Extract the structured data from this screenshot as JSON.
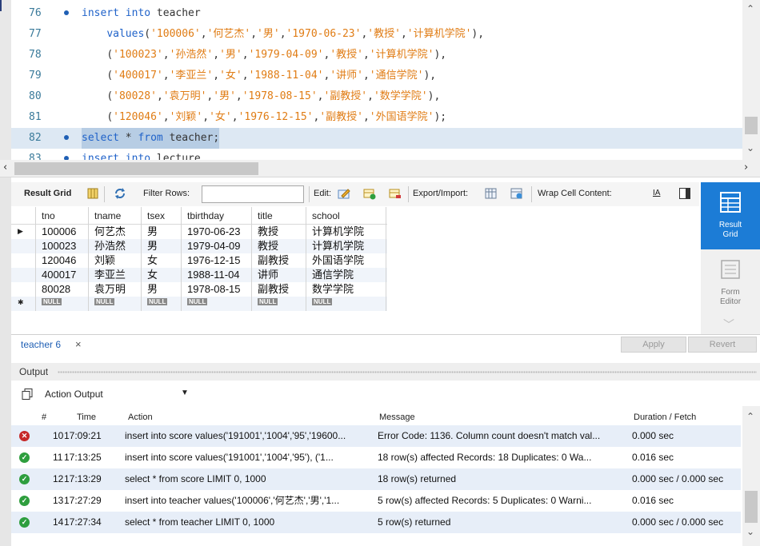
{
  "editor": {
    "lines": [
      {
        "num": "76",
        "dot": true,
        "parts": [
          [
            "kw",
            "insert into "
          ],
          [
            "id",
            "teacher"
          ]
        ]
      },
      {
        "num": "77",
        "dot": false,
        "parts": [
          [
            "id",
            "    "
          ],
          [
            "kw",
            "values"
          ],
          [
            "pun",
            "("
          ],
          [
            "str",
            "'100006'"
          ],
          [
            "pun",
            ","
          ],
          [
            "str",
            "'何艺杰'"
          ],
          [
            "pun",
            ","
          ],
          [
            "str",
            "'男'"
          ],
          [
            "pun",
            ","
          ],
          [
            "str",
            "'1970-06-23'"
          ],
          [
            "pun",
            ","
          ],
          [
            "str",
            "'教授'"
          ],
          [
            "pun",
            ","
          ],
          [
            "str",
            "'计算机学院'"
          ],
          [
            "pun",
            "),"
          ]
        ]
      },
      {
        "num": "78",
        "dot": false,
        "parts": [
          [
            "id",
            "    "
          ],
          [
            "pun",
            "("
          ],
          [
            "str",
            "'100023'"
          ],
          [
            "pun",
            ","
          ],
          [
            "str",
            "'孙浩然'"
          ],
          [
            "pun",
            ","
          ],
          [
            "str",
            "'男'"
          ],
          [
            "pun",
            ","
          ],
          [
            "str",
            "'1979-04-09'"
          ],
          [
            "pun",
            ","
          ],
          [
            "str",
            "'教授'"
          ],
          [
            "pun",
            ","
          ],
          [
            "str",
            "'计算机学院'"
          ],
          [
            "pun",
            "),"
          ]
        ]
      },
      {
        "num": "79",
        "dot": false,
        "parts": [
          [
            "id",
            "    "
          ],
          [
            "pun",
            "("
          ],
          [
            "str",
            "'400017'"
          ],
          [
            "pun",
            ","
          ],
          [
            "str",
            "'李亚兰'"
          ],
          [
            "pun",
            ","
          ],
          [
            "str",
            "'女'"
          ],
          [
            "pun",
            ","
          ],
          [
            "str",
            "'1988-11-04'"
          ],
          [
            "pun",
            ","
          ],
          [
            "str",
            "'讲师'"
          ],
          [
            "pun",
            ","
          ],
          [
            "str",
            "'通信学院'"
          ],
          [
            "pun",
            "),"
          ]
        ]
      },
      {
        "num": "80",
        "dot": false,
        "parts": [
          [
            "id",
            "    "
          ],
          [
            "pun",
            "("
          ],
          [
            "str",
            "'80028'"
          ],
          [
            "pun",
            ","
          ],
          [
            "str",
            "'袁万明'"
          ],
          [
            "pun",
            ","
          ],
          [
            "str",
            "'男'"
          ],
          [
            "pun",
            ","
          ],
          [
            "str",
            "'1978-08-15'"
          ],
          [
            "pun",
            ","
          ],
          [
            "str",
            "'副教授'"
          ],
          [
            "pun",
            ","
          ],
          [
            "str",
            "'数学学院'"
          ],
          [
            "pun",
            "),"
          ]
        ]
      },
      {
        "num": "81",
        "dot": false,
        "parts": [
          [
            "id",
            "    "
          ],
          [
            "pun",
            "("
          ],
          [
            "str",
            "'120046'"
          ],
          [
            "pun",
            ","
          ],
          [
            "str",
            "'刘颖'"
          ],
          [
            "pun",
            ","
          ],
          [
            "str",
            "'女'"
          ],
          [
            "pun",
            ","
          ],
          [
            "str",
            "'1976-12-15'"
          ],
          [
            "pun",
            ","
          ],
          [
            "str",
            "'副教授'"
          ],
          [
            "pun",
            ","
          ],
          [
            "str",
            "'外国语学院'"
          ],
          [
            "pun",
            ");"
          ]
        ]
      },
      {
        "num": "82",
        "dot": true,
        "hl": true,
        "parts": [
          [
            "kw",
            "select"
          ],
          [
            "id",
            " * "
          ],
          [
            "kw",
            "from "
          ],
          [
            "id",
            "teacher;"
          ]
        ]
      },
      {
        "num": "83",
        "dot": true,
        "parts": [
          [
            "kw",
            "insert into "
          ],
          [
            "id",
            "lecture"
          ]
        ]
      }
    ]
  },
  "toolbar": {
    "result_grid": "Result Grid",
    "filter_rows": "Filter Rows:",
    "edit": "Edit:",
    "export_import": "Export/Import:",
    "wrap": "Wrap Cell Content:",
    "wrap_icon_text": "IA"
  },
  "grid": {
    "columns": [
      "tno",
      "tname",
      "tsex",
      "tbirthday",
      "title",
      "school"
    ],
    "rows": [
      [
        "100006",
        "何艺杰",
        "男",
        "1970-06-23",
        "教授",
        "计算机学院"
      ],
      [
        "100023",
        "孙浩然",
        "男",
        "1979-04-09",
        "教授",
        "计算机学院"
      ],
      [
        "120046",
        "刘颖",
        "女",
        "1976-12-15",
        "副教授",
        "外国语学院"
      ],
      [
        "400017",
        "李亚兰",
        "女",
        "1988-11-04",
        "讲师",
        "通信学院"
      ],
      [
        "80028",
        "袁万明",
        "男",
        "1978-08-15",
        "副教授",
        "数学学院"
      ]
    ],
    "null_label": "NULL"
  },
  "side": {
    "result_grid_l1": "Result",
    "result_grid_l2": "Grid",
    "form_editor_l1": "Form",
    "form_editor_l2": "Editor"
  },
  "tabs": {
    "label": "teacher 6",
    "close": "×",
    "apply": "Apply",
    "revert": "Revert"
  },
  "output": {
    "title": "Output",
    "selector": "Action Output",
    "headers": [
      "#",
      "Time",
      "Action",
      "Message",
      "Duration / Fetch"
    ],
    "rows": [
      {
        "status": "error",
        "num": "10",
        "time": "17:09:21",
        "action": "insert into score values('191001','1004','95','19600...",
        "message": "Error Code: 1136. Column count doesn't match val...",
        "duration": "0.000 sec"
      },
      {
        "status": "ok",
        "num": "11",
        "time": "17:13:25",
        "action": "insert into score values('191001','1004','95'),    ('1...",
        "message": "18 row(s) affected Records: 18  Duplicates: 0  Wa...",
        "duration": "0.016 sec"
      },
      {
        "status": "ok",
        "num": "12",
        "time": "17:13:29",
        "action": "select * from score LIMIT 0, 1000",
        "message": "18 row(s) returned",
        "duration": "0.000 sec / 0.000 sec"
      },
      {
        "status": "ok",
        "num": "13",
        "time": "17:27:29",
        "action": "insert into teacher values('100006','何艺杰','男','1...",
        "message": "5 row(s) affected Records: 5  Duplicates: 0  Warni...",
        "duration": "0.016 sec"
      },
      {
        "status": "ok",
        "num": "14",
        "time": "17:27:34",
        "action": "select * from teacher LIMIT 0, 1000",
        "message": "5 row(s) returned",
        "duration": "0.000 sec / 0.000 sec"
      }
    ]
  },
  "colors": {
    "accent": "#1c7cd6",
    "keyword": "#1f62c9",
    "string": "#e07c14",
    "error": "#c62828",
    "ok": "#2e9e3e"
  }
}
